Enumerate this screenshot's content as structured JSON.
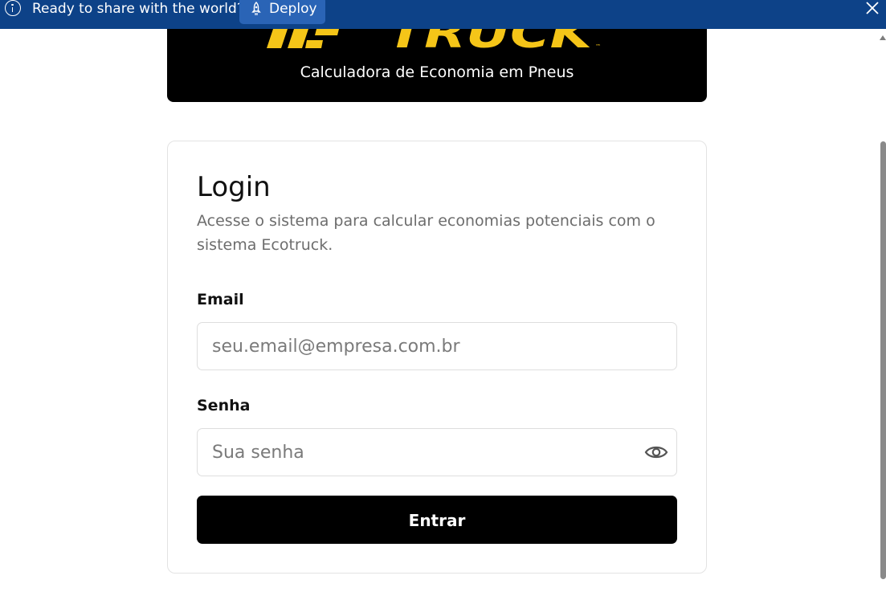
{
  "banner": {
    "message": "Ready to share with the world?",
    "deploy_label": "Deploy",
    "background_color": "#0d4288",
    "button_color": "#2a64b6"
  },
  "header": {
    "logo_text": "TRUCK",
    "logo_tm": "™",
    "subtitle": "Calculadora de Economia em Pneus",
    "logo_color": "#f5c518"
  },
  "login": {
    "title": "Login",
    "description": "Acesse o sistema para calcular economias potenciais com o sistema Ecotruck.",
    "email_label": "Email",
    "email_placeholder": "seu.email@empresa.com.br",
    "password_label": "Senha",
    "password_placeholder": "Sua senha",
    "submit_label": "Entrar"
  },
  "icons": {
    "info": "info-icon",
    "deploy": "rocket-icon",
    "close": "close-icon",
    "show_password": "eye-icon"
  }
}
